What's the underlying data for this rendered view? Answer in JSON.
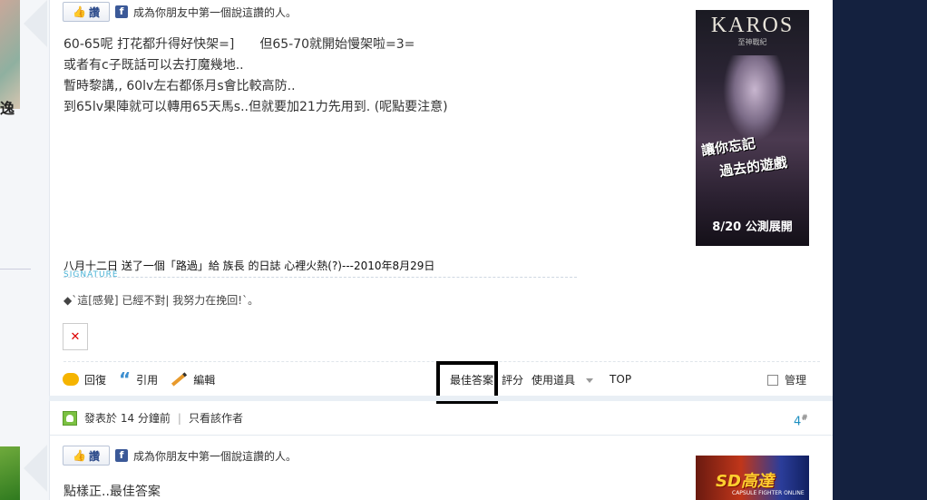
{
  "post1": {
    "like_label": "讚",
    "fb_text": "成為你朋友中第一個說這讚的人。",
    "body_lines": [
      "60-65呢 打花都升得好快架=]　　但65-70就開始慢架啦=3=",
      "或者有c子既話可以去打魔幾地..",
      "暫時黎講,, 60lv左右都係月s會比較高防..",
      "到65lv果陣就可以轉用65天馬s..但就要加21力先用到. (呢點要注意)"
    ],
    "signature_title": "八月十二日 送了一個「路過」給 族長 的日誌 心裡火熱(?)---2010年8月29日",
    "signature_label": "SIGNATURE",
    "signature_text": "◆`這[感覺] 已經不對|  我努力在挽回!`。",
    "broken_image_glyph": "✕",
    "actions": {
      "reply": "回復",
      "quote": "引用",
      "edit": "編輯",
      "best_answer": "最佳答案",
      "rate": "評分",
      "use_item": "使用道具",
      "top": "TOP",
      "manage": "管理"
    }
  },
  "post2": {
    "meta_posted": "發表於 14 分鐘前",
    "meta_sep": "|",
    "meta_author_only": "只看該作者",
    "floor": "4",
    "floor_mark": "#",
    "like_label": "讚",
    "fb_text": "成為你朋友中第一個說這讚的人。",
    "body": "點樣正..最佳答案"
  },
  "ads": {
    "karos_logo": "KAROS",
    "karos_sub": "至神戰紀",
    "karos_tagline1": "讓你忘記",
    "karos_tagline2": "過去的遊戲",
    "karos_footer": "8/20 公測展開",
    "sd_text": "SD高達",
    "sd_sub": "CAPSULE FIGHTER ONLINE"
  },
  "left": {
    "partial_char": "逸"
  },
  "colors": {
    "right_bar": "#14213f",
    "highlight_box": "#000000",
    "signature_label": "#4ab3d6",
    "floor_number": "#1c8fc0"
  },
  "icons": [
    "thumbs-up-icon",
    "facebook-icon",
    "reply-bubble-icon",
    "quote-icon",
    "pencil-icon",
    "dropdown-caret-icon",
    "checkbox",
    "user-icon",
    "broken-image-icon"
  ]
}
